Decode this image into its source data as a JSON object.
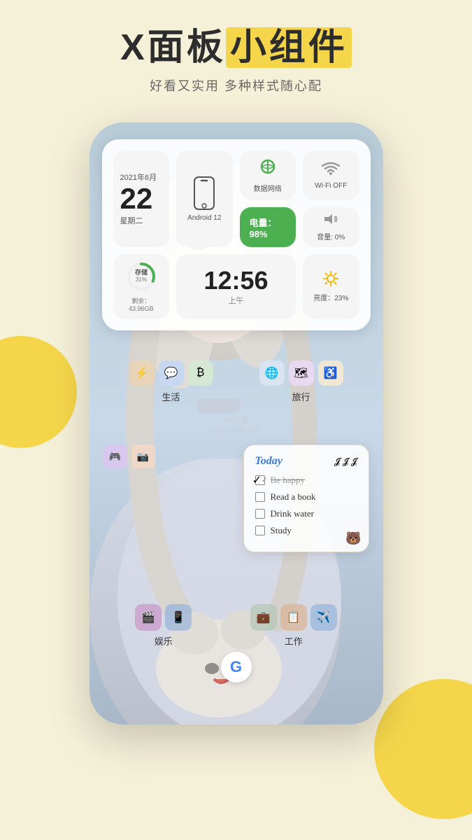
{
  "page": {
    "bg_color": "#f5f0d8"
  },
  "header": {
    "main_title_part1": "X面板小组件",
    "highlight_chars": "小组件",
    "subtitle": "好看又实用  多种样式随心配"
  },
  "widget": {
    "date": {
      "year_month": "2021年6月",
      "day": "22",
      "weekday": "星期二"
    },
    "network": {
      "label": "数据网络"
    },
    "wifi": {
      "label": "Wi-Fi OFF"
    },
    "battery": {
      "label": "电量：98%"
    },
    "volume": {
      "label": "音量: 0%"
    },
    "brightness": {
      "label": "亮度：23%"
    },
    "android": {
      "label": "Android 12"
    },
    "storage": {
      "label": "存储",
      "percent": "31%",
      "remaining": "剩余：43.96GB",
      "used": 31
    },
    "clock": {
      "time": "12:56",
      "ampm": "上午"
    }
  },
  "apps": {
    "row1_left_label": "生活",
    "row1_right_label": "旅行",
    "row2_left_label": "娱乐",
    "row2_right_label": "工作"
  },
  "todo": {
    "title": "Today",
    "decorations": [
      "𝓙",
      "𝓙",
      "𝓙"
    ],
    "items": [
      {
        "text": "Be happy",
        "checked": true,
        "strikethrough": true
      },
      {
        "text": "Read a book",
        "checked": false,
        "strikethrough": false
      },
      {
        "text": "Drink water",
        "checked": false,
        "strikethrough": false
      },
      {
        "text": "Study",
        "checked": false,
        "strikethrough": false
      }
    ]
  },
  "bottom": {
    "google_label": "G"
  },
  "watermark": {
    "line1": "KK下载",
    "line2": "www.kkkk.net"
  }
}
